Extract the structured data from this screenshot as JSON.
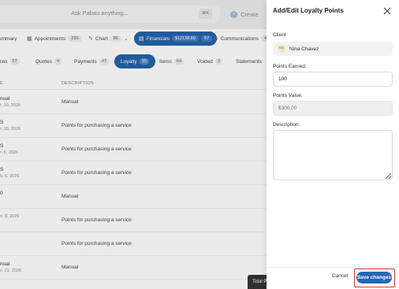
{
  "topbar": {
    "search_placeholder": "Ask Pabau anything...",
    "search_shortcut": "⌘K",
    "create_label": "Create"
  },
  "nav": {
    "items": [
      {
        "label": "ummary",
        "count": ""
      },
      {
        "label": "Appointments",
        "count": "230"
      },
      {
        "label": "Chart",
        "count": "86"
      },
      {
        "label": "Financials",
        "amount": "$12138.80",
        "count": "57"
      },
      {
        "label": "Communications",
        "count": "4"
      }
    ]
  },
  "tabs": [
    {
      "label": "ices",
      "count": "57"
    },
    {
      "label": "Quotes",
      "count": "4"
    },
    {
      "label": "Payments",
      "count": "47"
    },
    {
      "label": "Loyalty",
      "count": "10"
    },
    {
      "label": "Items",
      "count": "64"
    },
    {
      "label": "Voided",
      "count": "3"
    },
    {
      "label": "Statements",
      "count": ""
    }
  ],
  "table": {
    "col_ref": "E",
    "col_description": "DESCRIPTION",
    "rows": [
      {
        "ref": "nual",
        "date": "t. 10, 2026",
        "description": "Manual"
      },
      {
        "ref": "S",
        "date": "r. 10, 2026",
        "description": "Points for purchasing a service"
      },
      {
        "ref": "S",
        "date": "r. 6, 2026",
        "description": "Points for purchasing a service"
      },
      {
        "ref": "S",
        "date": "b. 6, 2026",
        "description": "Points for purchasing a service"
      },
      {
        "ref": "0",
        "date": "",
        "description": "Manual"
      },
      {
        "ref": "",
        "date": "n. 8, 2026",
        "description": "Points for purchasing a service"
      },
      {
        "ref": "",
        "date": "",
        "description": "Points for purchasing a service"
      },
      {
        "ref": "",
        "date": "",
        "description": "Points for purchasing a service"
      },
      {
        "ref": "nual",
        "date": "c. 21, 2026",
        "description": "Manual"
      }
    ]
  },
  "total_label": "Total P",
  "panel": {
    "title": "Add/Edit Loyalty Points",
    "client_label": "Client",
    "client_initials": "NC",
    "client_name": "Nina Chavez",
    "points_earned_label": "Points Earned:",
    "points_earned_value": "100",
    "points_value_label": "Points Value:",
    "points_value_placeholder": "$300.00",
    "description_label": "Description:",
    "description_value": "",
    "cancel_label": "Cancel",
    "save_label": "Save changes"
  }
}
